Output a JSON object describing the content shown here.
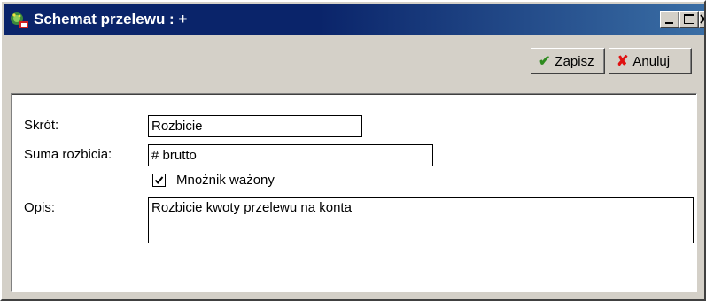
{
  "window": {
    "title": "Schemat przelewu : +",
    "app_icon": "app-colorful-icon"
  },
  "titlebar_buttons": [
    {
      "name": "minimize",
      "icon": "minimize-icon"
    },
    {
      "name": "maximize",
      "icon": "maximize-icon"
    },
    {
      "name": "close",
      "icon": "close-icon"
    }
  ],
  "toolbar": {
    "save": {
      "label": "Zapisz",
      "icon": "checkmark-icon",
      "icon_glyph": "✔",
      "color": "#2e8b1f"
    },
    "cancel": {
      "label": "Anuluj",
      "icon": "cross-icon",
      "icon_glyph": "✘",
      "color": "#e01010"
    }
  },
  "form": {
    "skrot": {
      "label": "Skrót:",
      "value": "Rozbicie"
    },
    "suma_rozbicia": {
      "label": "Suma rozbicia:",
      "value": "# brutto"
    },
    "mnoznik_wazony": {
      "label": "Mnożnik ważony",
      "checked": true
    },
    "opis": {
      "label": "Opis:",
      "value": "Rozbicie kwoty przelewu na konta"
    }
  },
  "colors": {
    "titlebar_start": "#0a246a",
    "titlebar_end": "#3a6ea5",
    "window_bg": "#d4d0c8",
    "panel_bg": "#ffffff"
  }
}
